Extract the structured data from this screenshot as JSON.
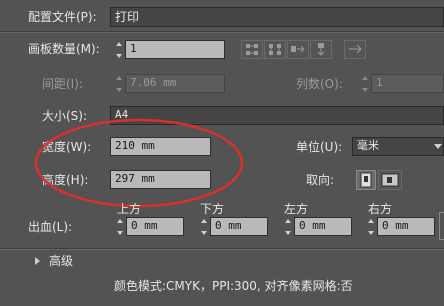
{
  "profile": {
    "label": "配置文件(P):",
    "value": "打印"
  },
  "artboards": {
    "label": "画板数量(M):",
    "value": "1"
  },
  "spacing": {
    "label": "间距(I):",
    "value": "7.06 mm"
  },
  "columns": {
    "label": "列数(O):",
    "value": "1"
  },
  "size": {
    "label": "大小(S):",
    "value": "A4"
  },
  "width": {
    "label": "宽度(W):",
    "value": "210 mm"
  },
  "height": {
    "label": "高度(H):",
    "value": "297 mm"
  },
  "units": {
    "label": "单位(U):",
    "value": "毫米"
  },
  "orientation": {
    "label": "取向:"
  },
  "bleed": {
    "label": "出血(L):",
    "top": {
      "label": "上方",
      "value": "0 mm"
    },
    "bottom": {
      "label": "下方",
      "value": "0 mm"
    },
    "left": {
      "label": "左方",
      "value": "0 mm"
    },
    "right": {
      "label": "右方",
      "value": "0 mm"
    }
  },
  "advanced": {
    "label": "高级"
  },
  "summary": "颜色模式:CMYK，PPI:300, 对齐像素网格:否",
  "colors": {
    "panel_bg": "#535353",
    "field_bg": "#b9b9b9",
    "highlight_ellipse": "#d8302a"
  },
  "icons": [
    "grid-by-row-icon",
    "grid-by-column-icon",
    "arrange-by-row-icon",
    "arrange-by-column-icon",
    "right-to-left-icon",
    "portrait-icon",
    "landscape-icon",
    "expand-triangle-icon"
  ]
}
